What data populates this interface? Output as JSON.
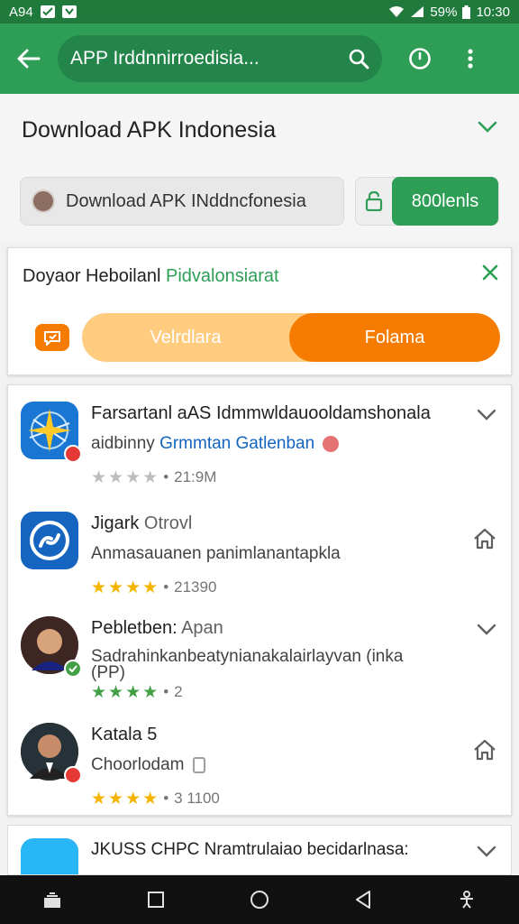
{
  "status_bar": {
    "time_left": "A94",
    "battery": "59%",
    "time": "10:30"
  },
  "app_bar": {
    "search_text": "APP Irddnnirroedisia..."
  },
  "header": {
    "title": "Download APK Indonesia",
    "chip_text": "Download APK INddncfonesia",
    "install_label": "800lenls"
  },
  "promo": {
    "title_main": "Doyaor Heboilanl",
    "title_accent": "Pidvalonsiarat",
    "toggle_left": "Velrdlara",
    "toggle_right": "Folama",
    "colors": {
      "accent": "#f57c00",
      "accent_light": "#ffcc80"
    }
  },
  "apps": [
    {
      "title": "Farsartanl aAS Idmmwldauooldamshonala",
      "subtitle_plain": "aidbinny",
      "subtitle_link": "Grmmtan Gatlenban",
      "rating_count": "21:9M",
      "stars_filled": 0,
      "star_color": "#bdbdbd",
      "icon": "compass-star-icon",
      "action": "chevron-down-icon"
    },
    {
      "title": "Jigark",
      "title_muted": "Otrovl",
      "subtitle_plain": "Anmasauanen panimlanantapkla",
      "subtitle_link": "",
      "rating_count": "21390",
      "stars_filled": 4,
      "star_color": "#f5b400",
      "icon": "link-icon",
      "action": "home-icon"
    },
    {
      "title": "Pebletben:",
      "title_muted": "Apan",
      "subtitle_plain": "Sadrahinkanbeatynianakalairlayvan (inka (PP)",
      "subtitle_link": "",
      "rating_count": "2",
      "stars_filled": 4,
      "star_color": "#43a047",
      "icon": "person-avatar",
      "action": "chevron-down-icon"
    },
    {
      "title": "Katala 5",
      "title_muted": "",
      "subtitle_plain": "Choorlodam",
      "subtitle_link": "",
      "rating_count": "3 1100",
      "stars_filled": 4,
      "star_color": "#f5b400",
      "icon": "person-avatar",
      "action": "home-icon"
    }
  ],
  "partial_item": {
    "title": "JKUSS CHPC Nramtrulaiao bеcidarlnasa:"
  },
  "rating_separator": "•",
  "star_glyph": "★"
}
